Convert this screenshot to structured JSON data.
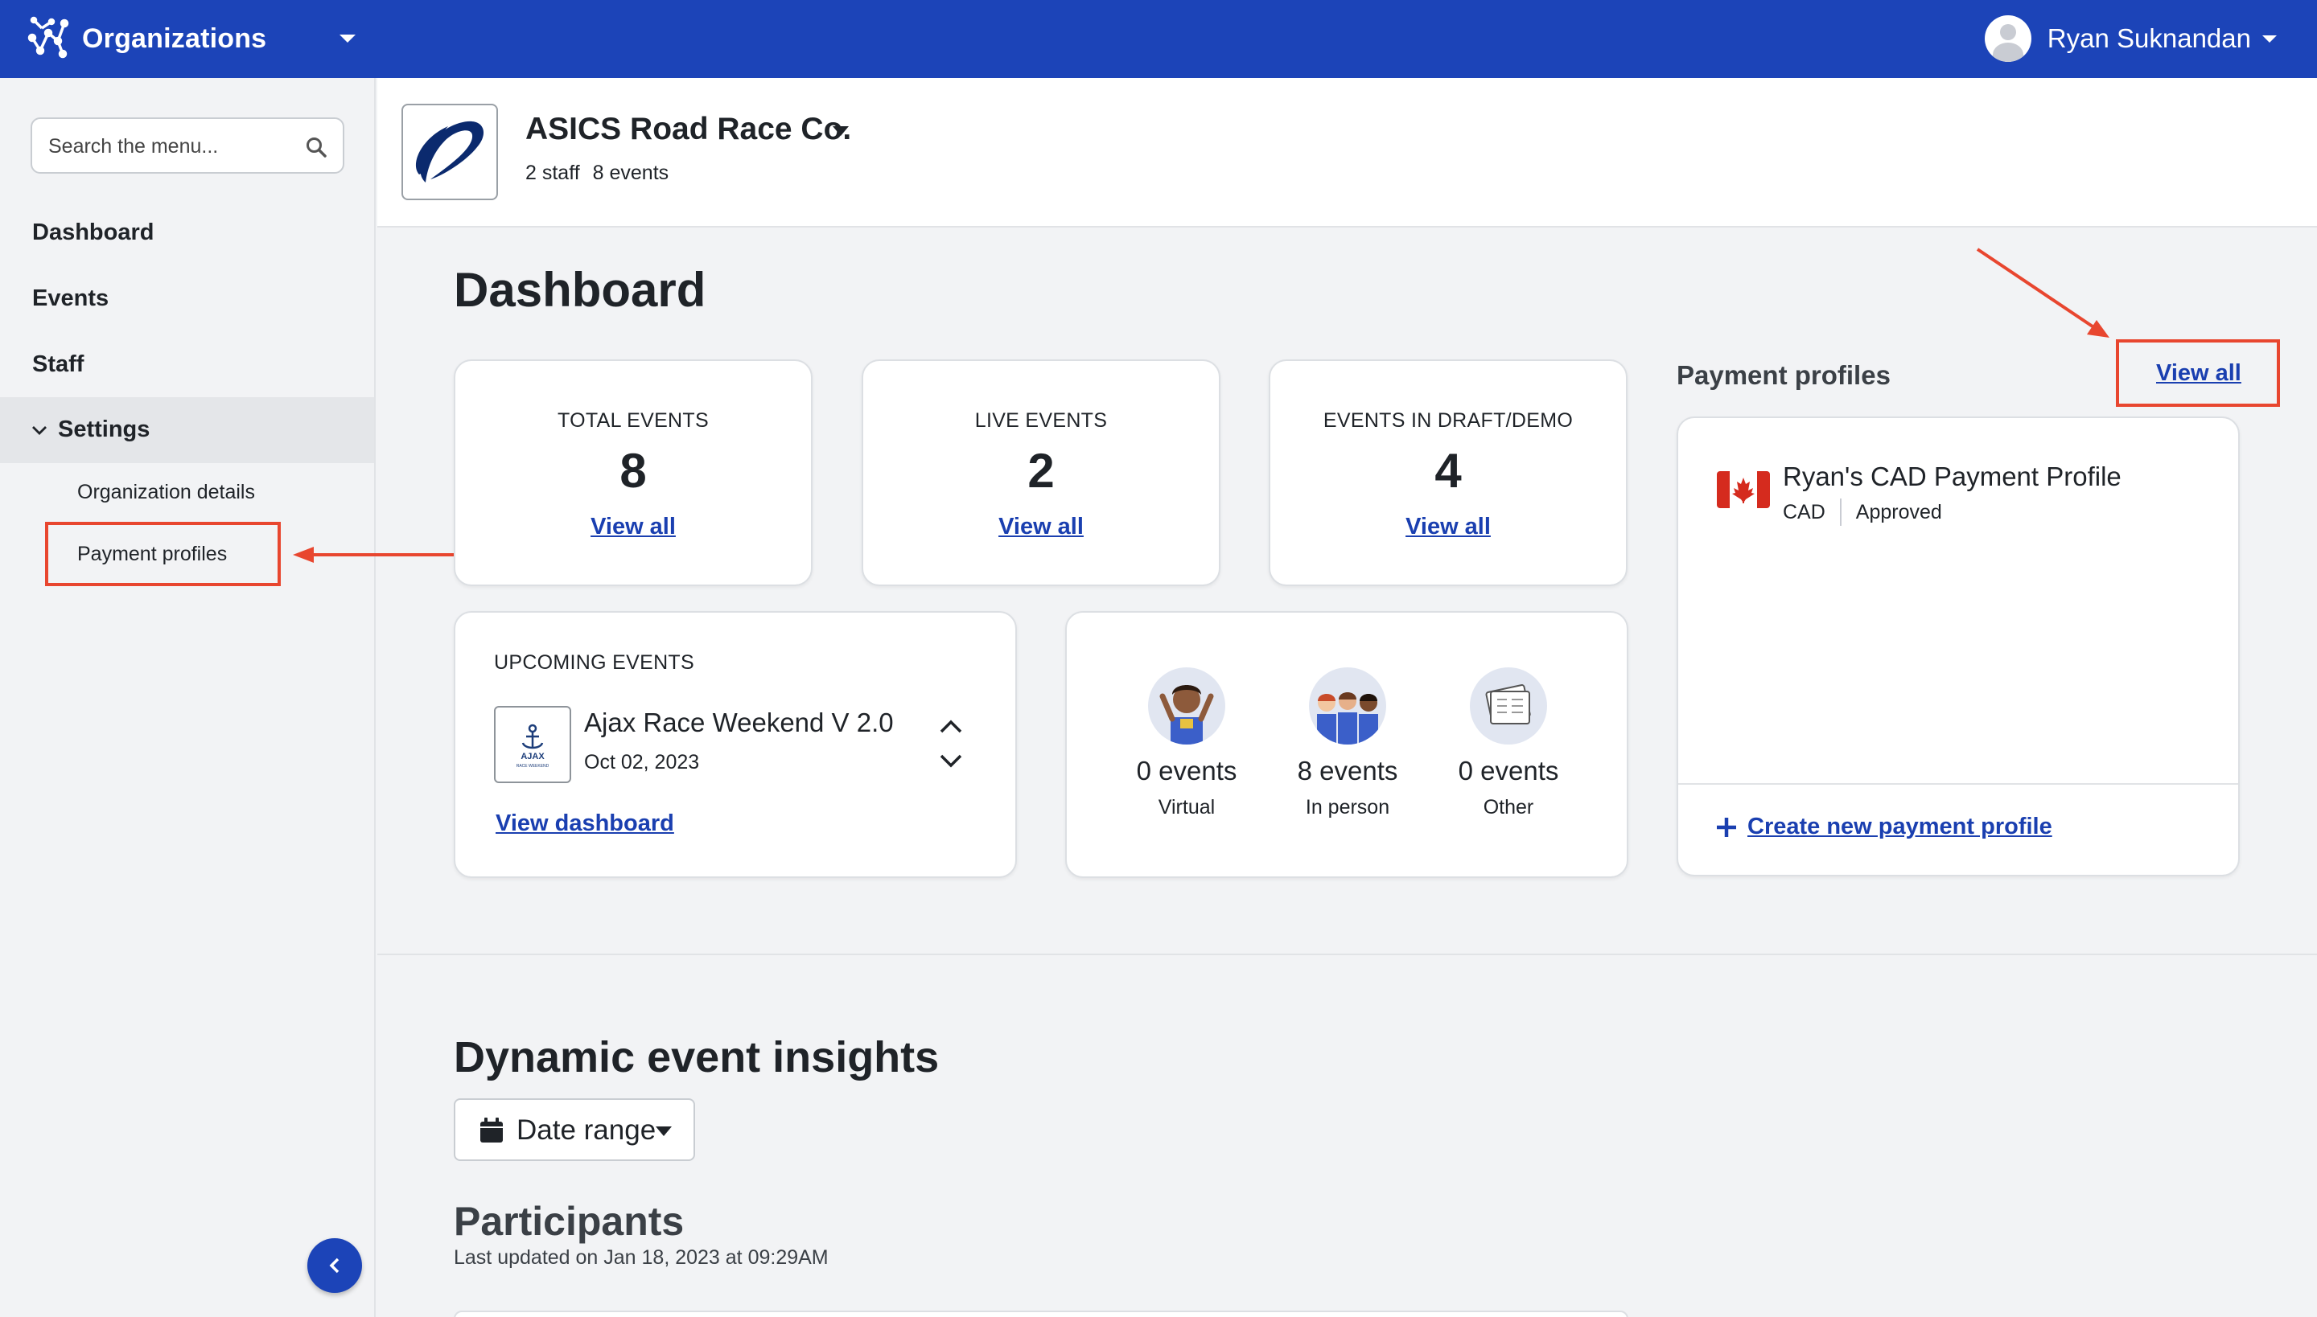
{
  "topbar": {
    "title": "Organizations",
    "user_name": "Ryan Suknandan",
    "logo_icon": "network-graph-icon",
    "bg_color": "#1c44b8"
  },
  "sidebar": {
    "search_placeholder": "Search the menu...",
    "items": [
      {
        "label": "Dashboard"
      },
      {
        "label": "Events"
      },
      {
        "label": "Staff"
      },
      {
        "label": "Settings",
        "expanded": true
      }
    ],
    "settings_children": [
      {
        "label": "Organization details"
      },
      {
        "label": "Payment profiles",
        "highlighted": true
      }
    ]
  },
  "org": {
    "name": "ASICS Road Race Co.",
    "staff": "2 staff",
    "events": "8 events"
  },
  "dashboard": {
    "title": "Dashboard",
    "stats": [
      {
        "label": "TOTAL EVENTS",
        "value": "8",
        "link": "View all"
      },
      {
        "label": "LIVE EVENTS",
        "value": "2",
        "link": "View all"
      },
      {
        "label": "EVENTS IN DRAFT/DEMO",
        "value": "4",
        "link": "View all"
      }
    ],
    "upcoming": {
      "title": "UPCOMING EVENTS",
      "event_name": "Ajax Race Weekend V 2.0",
      "event_date": "Oct 02, 2023",
      "link": "View dashboard",
      "logo_text": "AJAX",
      "logo_subtext": "RACE WEEKEND"
    },
    "event_types": [
      {
        "count": "0 events",
        "label": "Virtual",
        "icon": "virtual-runner-icon"
      },
      {
        "count": "8 events",
        "label": "In person",
        "icon": "in-person-group-icon"
      },
      {
        "count": "0 events",
        "label": "Other",
        "icon": "tickets-icon"
      }
    ]
  },
  "payment_profiles": {
    "title": "Payment profiles",
    "view_all": "View all",
    "profile_name": "Ryan's CAD Payment Profile",
    "currency": "CAD",
    "status": "Approved",
    "flag_icon": "canada-flag-icon",
    "create_link": "Create new payment profile"
  },
  "insights": {
    "title": "Dynamic event insights",
    "date_range_label": "Date range",
    "participants_title": "Participants",
    "last_updated": "Last updated on Jan 18, 2023 at 09:29AM"
  },
  "colors": {
    "accent": "#1c44b8",
    "link": "#1a3fb0",
    "annotation": "#e8462f"
  }
}
